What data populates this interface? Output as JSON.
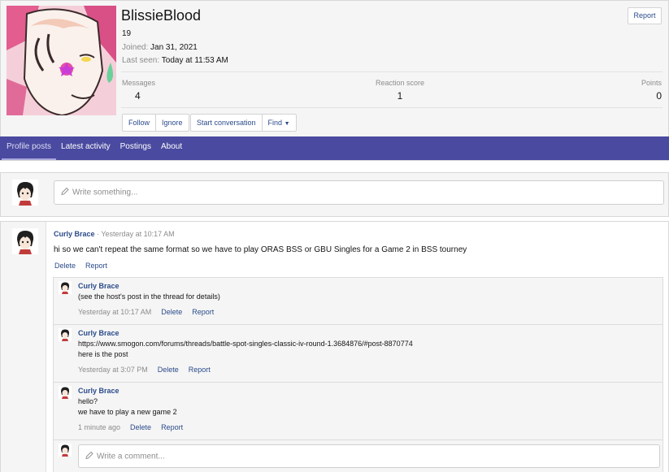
{
  "profile": {
    "username": "BlissieBlood",
    "age": "19",
    "joined_label": "Joined:",
    "joined_value": "Jan 31, 2021",
    "last_seen_label": "Last seen:",
    "last_seen_value": "Today at 11:53 AM",
    "report_label": "Report",
    "stats": {
      "messages_label": "Messages",
      "messages_value": "4",
      "reaction_label": "Reaction score",
      "reaction_value": "1",
      "points_label": "Points",
      "points_value": "0"
    },
    "buttons": {
      "follow": "Follow",
      "ignore": "Ignore",
      "start_conversation": "Start conversation",
      "find": "Find"
    }
  },
  "tabs": [
    {
      "label": "Profile posts",
      "active": true
    },
    {
      "label": "Latest activity",
      "active": false
    },
    {
      "label": "Postings",
      "active": false
    },
    {
      "label": "About",
      "active": false
    }
  ],
  "write": {
    "placeholder": "Write something..."
  },
  "post": {
    "author": "Curly Brace",
    "separator": " · ",
    "time": "Yesterday at 10:17 AM",
    "text": "hi so we can't repeat the same format so we have to play ORAS BSS or GBU Singles for a Game 2 in BSS tourney",
    "delete_label": "Delete",
    "report_label": "Report"
  },
  "comments": [
    {
      "author": "Curly Brace",
      "lines": [
        "(see the host's post in the thread for details)"
      ],
      "time": "Yesterday at 10:17 AM",
      "delete_label": "Delete",
      "report_label": "Report"
    },
    {
      "author": "Curly Brace",
      "link": "https://www.smogon.com/forums/threads/battle-spot-singles-classic-iv-round-1.3684876/#post-8870774",
      "lines": [
        "here is the post"
      ],
      "time": "Yesterday at 3:07 PM",
      "delete_label": "Delete",
      "report_label": "Report"
    },
    {
      "author": "Curly Brace",
      "lines": [
        "hello?",
        "we have to play a new game 2"
      ],
      "time": "1 minute ago",
      "delete_label": "Delete",
      "report_label": "Report"
    }
  ],
  "comment_box": {
    "placeholder": "Write a comment..."
  },
  "icons": {
    "pencil": "pencil-icon",
    "caret": "caret-down-icon"
  },
  "colors": {
    "tabbar": "#4a4aa0",
    "link": "#2b4b8a"
  }
}
